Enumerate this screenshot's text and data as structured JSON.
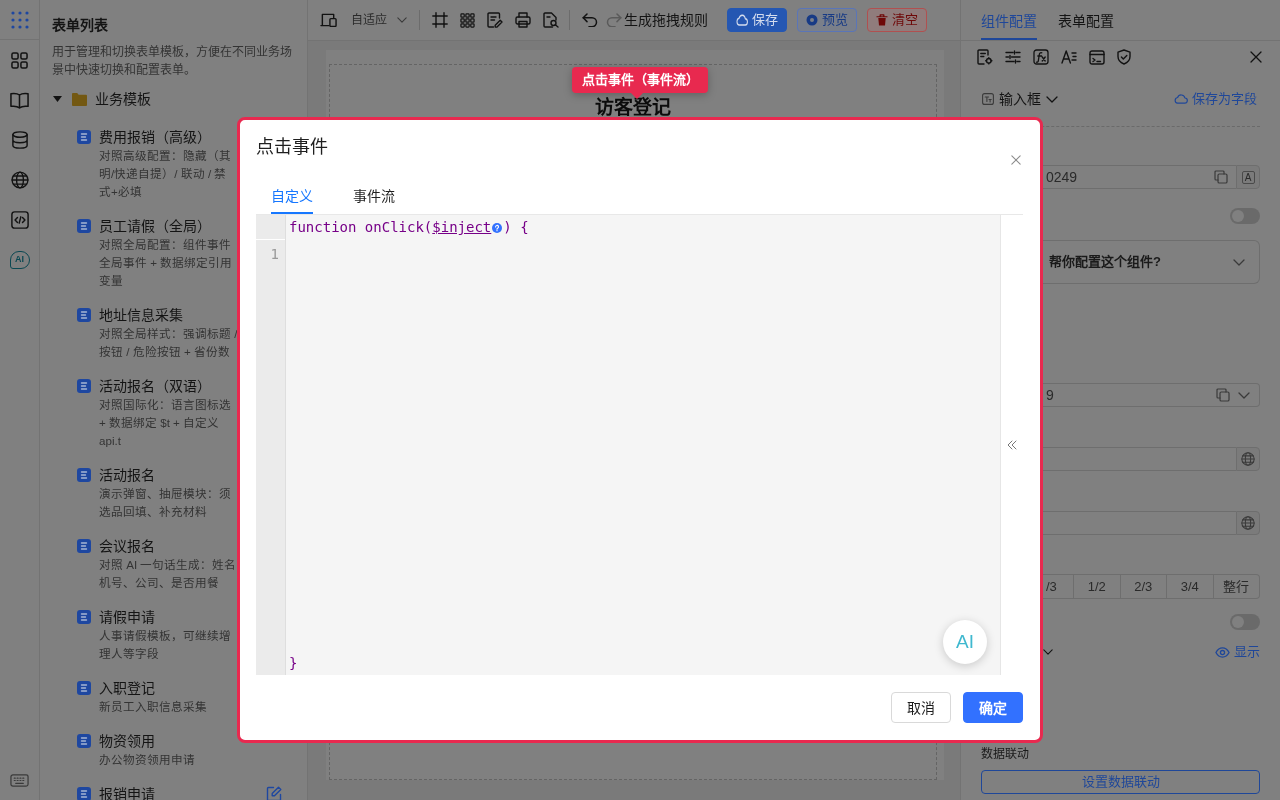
{
  "rail": {
    "ai_label": "AI"
  },
  "sidebar": {
    "title": "表单列表",
    "description": "用于管理和切换表单模板，方便在不同业务场景中快速切换和配置表单。",
    "folder": {
      "label": "业务模板",
      "expanded": true,
      "items": [
        {
          "title": "费用报销（高级）",
          "description": [
            "对照高级配置：隐藏（其",
            "明/快递自提）/ 联动 / 禁",
            "式+必填"
          ]
        },
        {
          "title": "员工请假（全局）",
          "description": [
            "对照全局配置：组件事件",
            "全局事件 + 数据绑定引用",
            "变量"
          ]
        },
        {
          "title": "地址信息采集",
          "description": [
            "对照全局样式：强调标题 /",
            "按钮 / 危险按钮 + 省份数"
          ]
        },
        {
          "title": "活动报名（双语）",
          "description": [
            "对照国际化：语言图标选",
            "+ 数据绑定 $t + 自定义",
            "api.t"
          ]
        },
        {
          "title": "活动报名",
          "description": [
            "演示弹窗、抽屉模块：须",
            "选品回填、补充材料"
          ]
        },
        {
          "title": "会议报名",
          "description": [
            "对照 AI 一句话生成：姓名",
            "机号、公司、是否用餐"
          ]
        },
        {
          "title": "请假申请",
          "description": [
            "人事请假模板，可继续增",
            "理人等字段"
          ]
        },
        {
          "title": "入职登记",
          "description": [
            "新员工入职信息采集"
          ]
        },
        {
          "title": "物资领用",
          "description": [
            "办公物资领用申请"
          ]
        },
        {
          "title": "报销申请",
          "edit_icon": true
        }
      ]
    }
  },
  "toolbar": {
    "device_mode": "自适应",
    "undo": {
      "disabled": false
    },
    "redo": {
      "disabled": true
    },
    "rule_text": "生成拖拽规则",
    "buttons": [
      {
        "label": "保存",
        "kind": "primary"
      },
      {
        "label": "预览",
        "kind": "outline"
      },
      {
        "label": "清空",
        "kind": "danger"
      }
    ]
  },
  "canvas": {
    "title": "访客登记"
  },
  "tour_tip": {
    "text": "点击事件（事件流）"
  },
  "right_panel": {
    "tabs": [
      {
        "label": "组件配置",
        "selected": true
      },
      {
        "label": "表单配置",
        "selected": false
      }
    ],
    "component_type": "输入框",
    "save_as_field": "保存为字段",
    "rows": [
      {
        "kind": "id_field",
        "value": "0249",
        "addon": "A"
      },
      {
        "kind": "switch",
        "on": false
      },
      {
        "kind": "ai_assist",
        "text": "帮你配置这个组件?",
        "expanded": false
      },
      {
        "kind": "select",
        "value": "9"
      },
      {
        "kind": "i18n_input"
      },
      {
        "kind": "i18n_input"
      },
      {
        "kind": "segmented",
        "options": [
          {
            "label": "/3",
            "selected": false
          },
          {
            "label": "1/2",
            "selected": false
          },
          {
            "label": "2/3",
            "selected": false
          },
          {
            "label": "3/4",
            "selected": false
          },
          {
            "label": "整行",
            "selected": false
          }
        ]
      },
      {
        "kind": "switch",
        "on": false
      },
      {
        "kind": "visibility",
        "text": "显示"
      },
      {
        "kind": "linkage",
        "label": "数据联动",
        "button": "设置数据联动"
      }
    ]
  },
  "modal": {
    "title": "点击事件",
    "tabs": [
      {
        "label": "自定义",
        "selected": true
      },
      {
        "label": "事件流",
        "selected": false
      }
    ],
    "editor": {
      "signature": {
        "prefix": "function onClick(",
        "param": "$inject",
        "suffix": ") {"
      },
      "line_numbers": [
        "1"
      ],
      "closing": "}"
    },
    "ai_button": "AI",
    "buttons": [
      {
        "label": "取消",
        "kind": "default"
      },
      {
        "label": "确定",
        "kind": "primary"
      }
    ]
  }
}
